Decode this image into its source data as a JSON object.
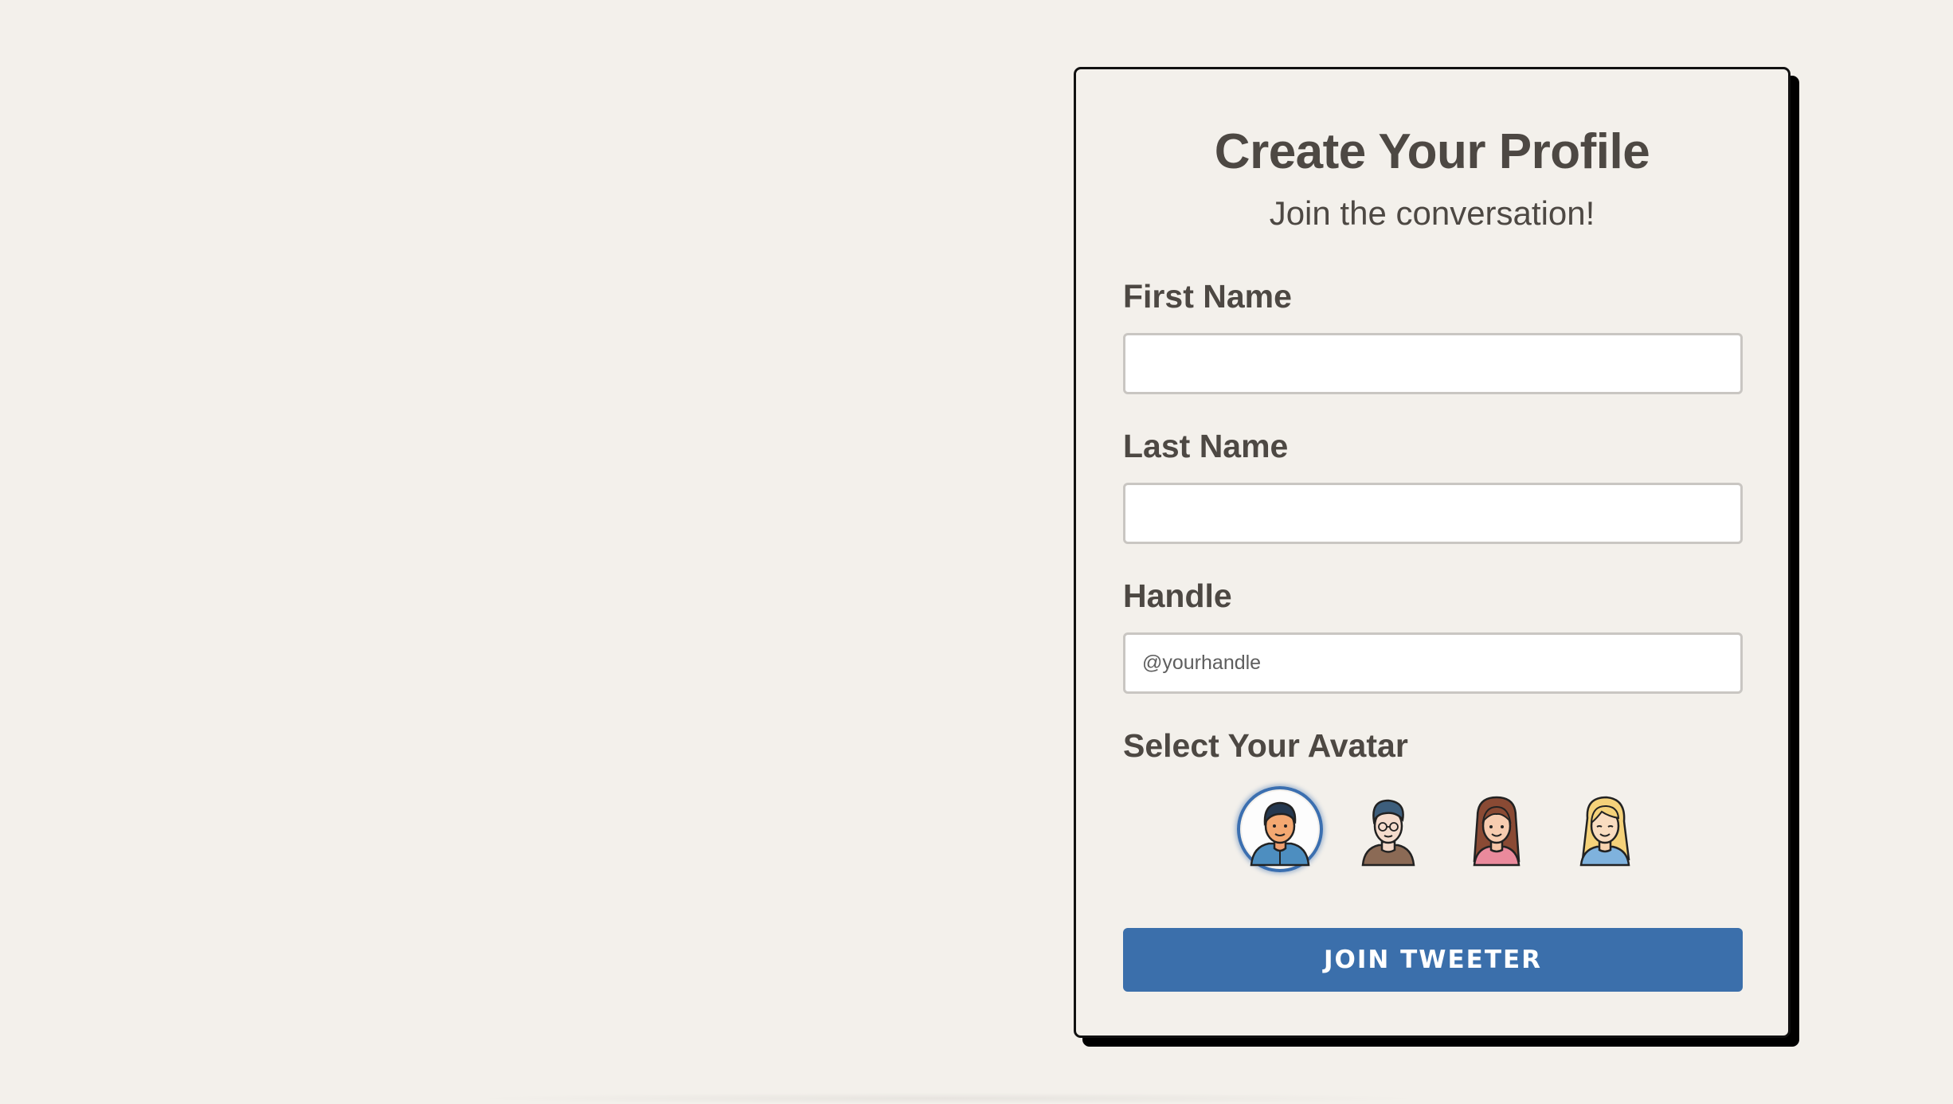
{
  "form": {
    "title": "Create Your Profile",
    "subtitle": "Join the conversation!",
    "first_name": {
      "label": "First Name",
      "value": "",
      "placeholder": ""
    },
    "last_name": {
      "label": "Last Name",
      "value": "",
      "placeholder": ""
    },
    "handle": {
      "label": "Handle",
      "value": "",
      "placeholder": "@yourhandle"
    },
    "avatar": {
      "label": "Select Your Avatar",
      "options": [
        "man-dark-hair-avatar-icon",
        "man-glasses-avatar-icon",
        "woman-brown-hair-avatar-icon",
        "woman-blonde-hair-avatar-icon"
      ],
      "selected_index": 0
    },
    "submit_label": "Join Tweeter"
  },
  "colors": {
    "background": "#f3f0eb",
    "text": "#4d4843",
    "accent": "#3b6fab",
    "card_border": "#111111"
  }
}
